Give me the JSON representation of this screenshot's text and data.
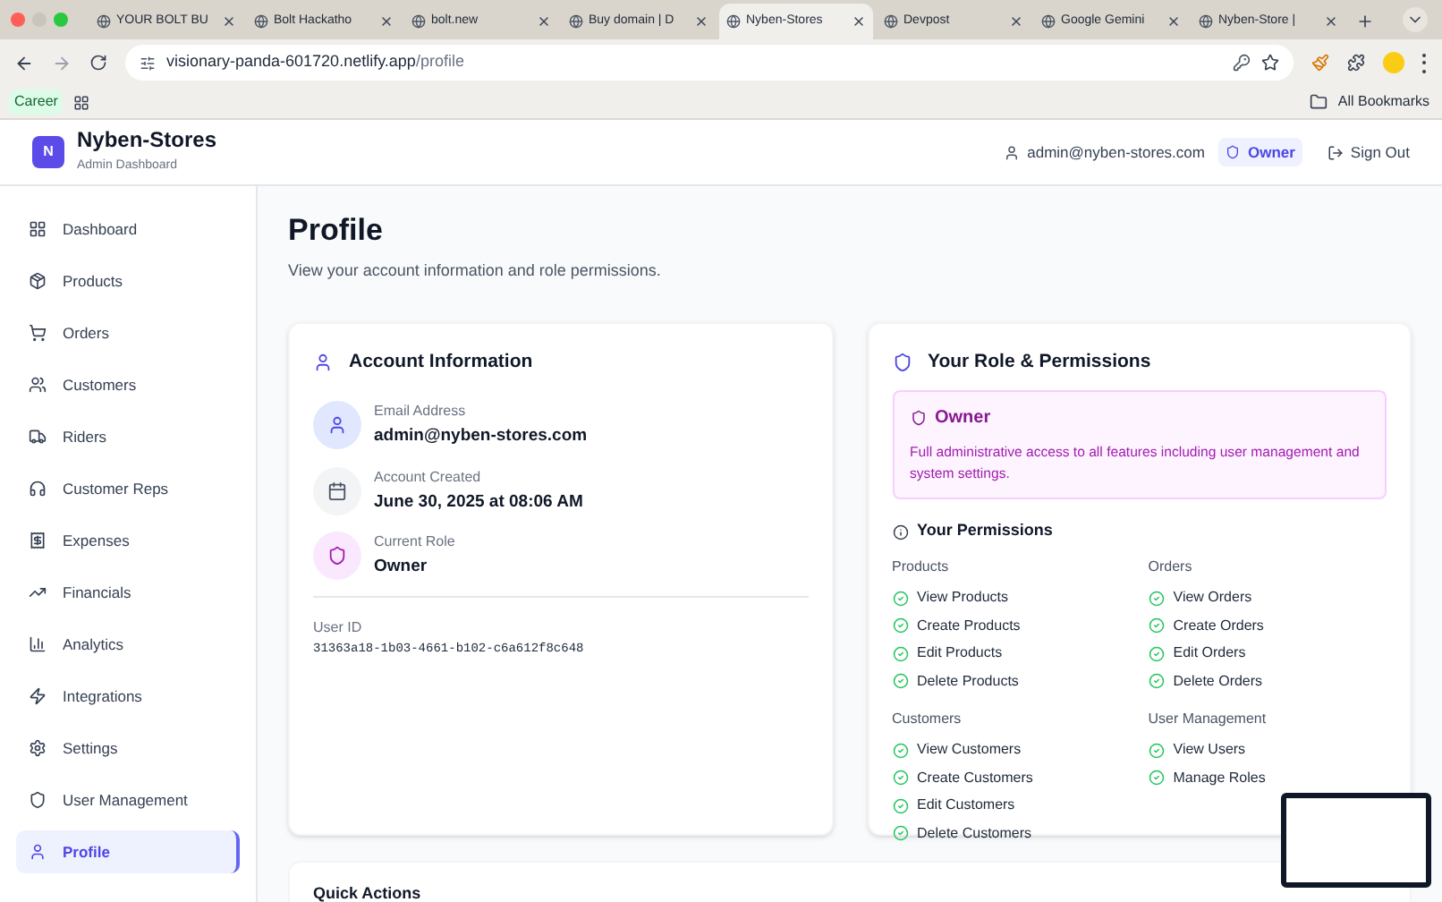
{
  "browser": {
    "tabs": [
      {
        "title": "YOUR BOLT BU",
        "selected": false
      },
      {
        "title": "Bolt Hackatho",
        "selected": false
      },
      {
        "title": "bolt.new",
        "selected": false
      },
      {
        "title": "Buy domain | D",
        "selected": false
      },
      {
        "title": "Nyben-Stores",
        "selected": true
      },
      {
        "title": "Devpost",
        "selected": false
      },
      {
        "title": "Google Gemini",
        "selected": false
      },
      {
        "title": "Nyben-Store |",
        "selected": false
      }
    ],
    "url_host": "visionary-panda-601720.netlify.app",
    "url_path": "/profile",
    "bookmark": "Career",
    "all_bookmarks": "All Bookmarks"
  },
  "header": {
    "logo_letter": "N",
    "title": "Nyben-Stores",
    "subtitle": "Admin Dashboard",
    "user_email": "admin@nyben-stores.com",
    "role": "Owner",
    "sign_out": "Sign Out"
  },
  "sidebar": {
    "items": [
      {
        "label": "Dashboard",
        "selected": false
      },
      {
        "label": "Products",
        "selected": false
      },
      {
        "label": "Orders",
        "selected": false
      },
      {
        "label": "Customers",
        "selected": false
      },
      {
        "label": "Riders",
        "selected": false
      },
      {
        "label": "Customer Reps",
        "selected": false
      },
      {
        "label": "Expenses",
        "selected": false
      },
      {
        "label": "Financials",
        "selected": false
      },
      {
        "label": "Analytics",
        "selected": false
      },
      {
        "label": "Integrations",
        "selected": false
      },
      {
        "label": "Settings",
        "selected": false
      },
      {
        "label": "User Management",
        "selected": false
      },
      {
        "label": "Profile",
        "selected": true
      }
    ]
  },
  "page": {
    "title": "Profile",
    "subtitle": "View your account information and role permissions."
  },
  "account": {
    "title": "Account Information",
    "fields": [
      {
        "kind": "email",
        "label": "Email Address",
        "value": "admin@nyben-stores.com"
      },
      {
        "kind": "date",
        "label": "Account Created",
        "value": "June 30, 2025 at 08:06 AM"
      },
      {
        "kind": "role",
        "label": "Current Role",
        "value": "Owner"
      }
    ],
    "user_id_label": "User ID",
    "user_id": "31363a18-1b03-4661-b102-c6a612f8c648"
  },
  "permissions": {
    "title": "Your Role & Permissions",
    "role_name": "Owner",
    "role_description": "Full administrative access to all features including user management and system settings.",
    "section_title": "Your Permissions",
    "groups": [
      {
        "name": "Products",
        "items": [
          {
            "label": "View Products",
            "granted": true
          },
          {
            "label": "Create Products",
            "granted": true
          },
          {
            "label": "Edit Products",
            "granted": true
          },
          {
            "label": "Delete Products",
            "granted": true
          }
        ]
      },
      {
        "name": "Orders",
        "items": [
          {
            "label": "View Orders",
            "granted": true
          },
          {
            "label": "Create Orders",
            "granted": true
          },
          {
            "label": "Edit Orders",
            "granted": true
          },
          {
            "label": "Delete Orders",
            "granted": true
          }
        ]
      },
      {
        "name": "Customers",
        "items": [
          {
            "label": "View Customers",
            "granted": true
          },
          {
            "label": "Create Customers",
            "granted": true
          },
          {
            "label": "Edit Customers",
            "granted": true
          },
          {
            "label": "Delete Customers",
            "granted": true
          }
        ]
      },
      {
        "name": "User Management",
        "items": [
          {
            "label": "View Users",
            "granted": true
          },
          {
            "label": "Manage Roles",
            "granted": true
          }
        ]
      }
    ]
  },
  "quick_actions": {
    "title": "Quick Actions"
  }
}
